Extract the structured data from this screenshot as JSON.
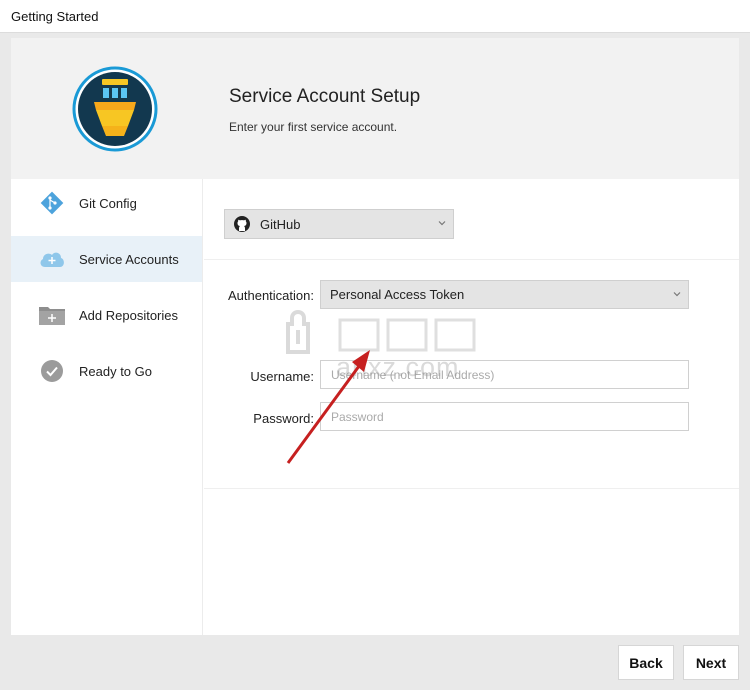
{
  "window": {
    "title": "Getting Started"
  },
  "header": {
    "title": "Service Account Setup",
    "subtitle": "Enter your first service account."
  },
  "sidebar": {
    "items": [
      {
        "label": "Git Config",
        "icon": "git-config-icon",
        "active": false
      },
      {
        "label": "Service Accounts",
        "icon": "cloud-add-icon",
        "active": true
      },
      {
        "label": "Add Repositories",
        "icon": "folder-add-icon",
        "active": false
      },
      {
        "label": "Ready to Go",
        "icon": "checkmark-icon",
        "active": false
      }
    ]
  },
  "form": {
    "provider": {
      "value": "GitHub",
      "icon": "github-icon"
    },
    "authentication": {
      "label": "Authentication:",
      "value": "Personal Access Token"
    },
    "username": {
      "label": "Username:",
      "placeholder": "Username (not Email Address)",
      "value": ""
    },
    "password": {
      "label": "Password:",
      "placeholder": "Password",
      "value": ""
    }
  },
  "footer": {
    "back_label": "Back",
    "next_label": "Next"
  },
  "watermark": {
    "text": "anxz.com"
  },
  "colors": {
    "accent": "#e8f1f8",
    "arrow": "#c62020",
    "logo_ring": "#1a9ad6",
    "logo_fill": "#f7c623"
  }
}
